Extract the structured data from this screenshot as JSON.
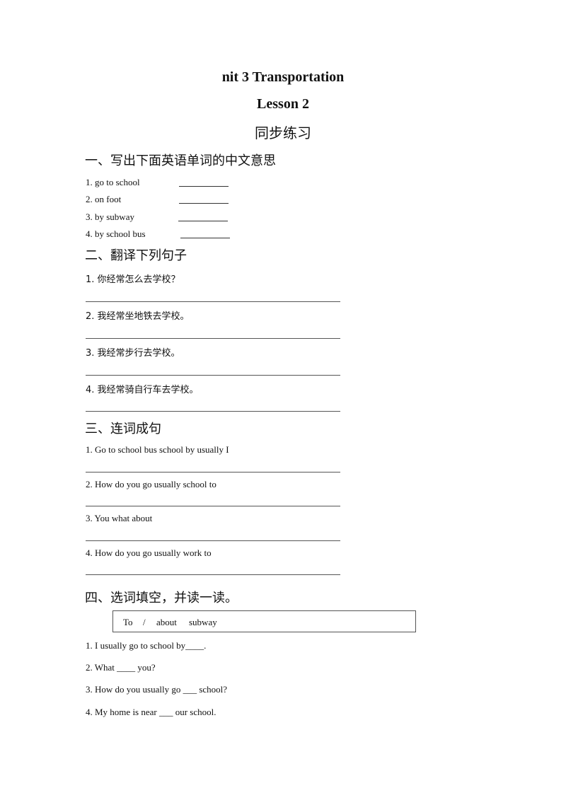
{
  "header": {
    "title": "nit 3 Transportation",
    "lesson": "Lesson 2",
    "subtitle": "同步练习"
  },
  "section1": {
    "heading": "一、写出下面英语单词的中文意思",
    "items": [
      "1. go to school",
      "2. on foot",
      "3. by subway",
      "4. by school bus"
    ]
  },
  "section2": {
    "heading": "二、翻译下列句子",
    "items": [
      "1.  你经常怎么去学校？",
      "2.  我经常坐地铁去学校。",
      "3.  我经常步行去学校。",
      "4.  我经常骑自行车去学校。"
    ]
  },
  "section3": {
    "heading": "三、连词成句",
    "items": [
      "1. Go to school bus school by usually I",
      "2. How do you go usually school to",
      "3. You  what about",
      "4. How do you go usually work to"
    ]
  },
  "section4": {
    "heading": "四、选词填空，并读一读。",
    "word_bank": [
      "To",
      "/",
      "about",
      "subway"
    ],
    "items": [
      "1. I usually go to school by____.",
      "2. What ____ you?",
      "3. How do you usually go ___ school?",
      "4. My home is near ___ our school."
    ]
  }
}
